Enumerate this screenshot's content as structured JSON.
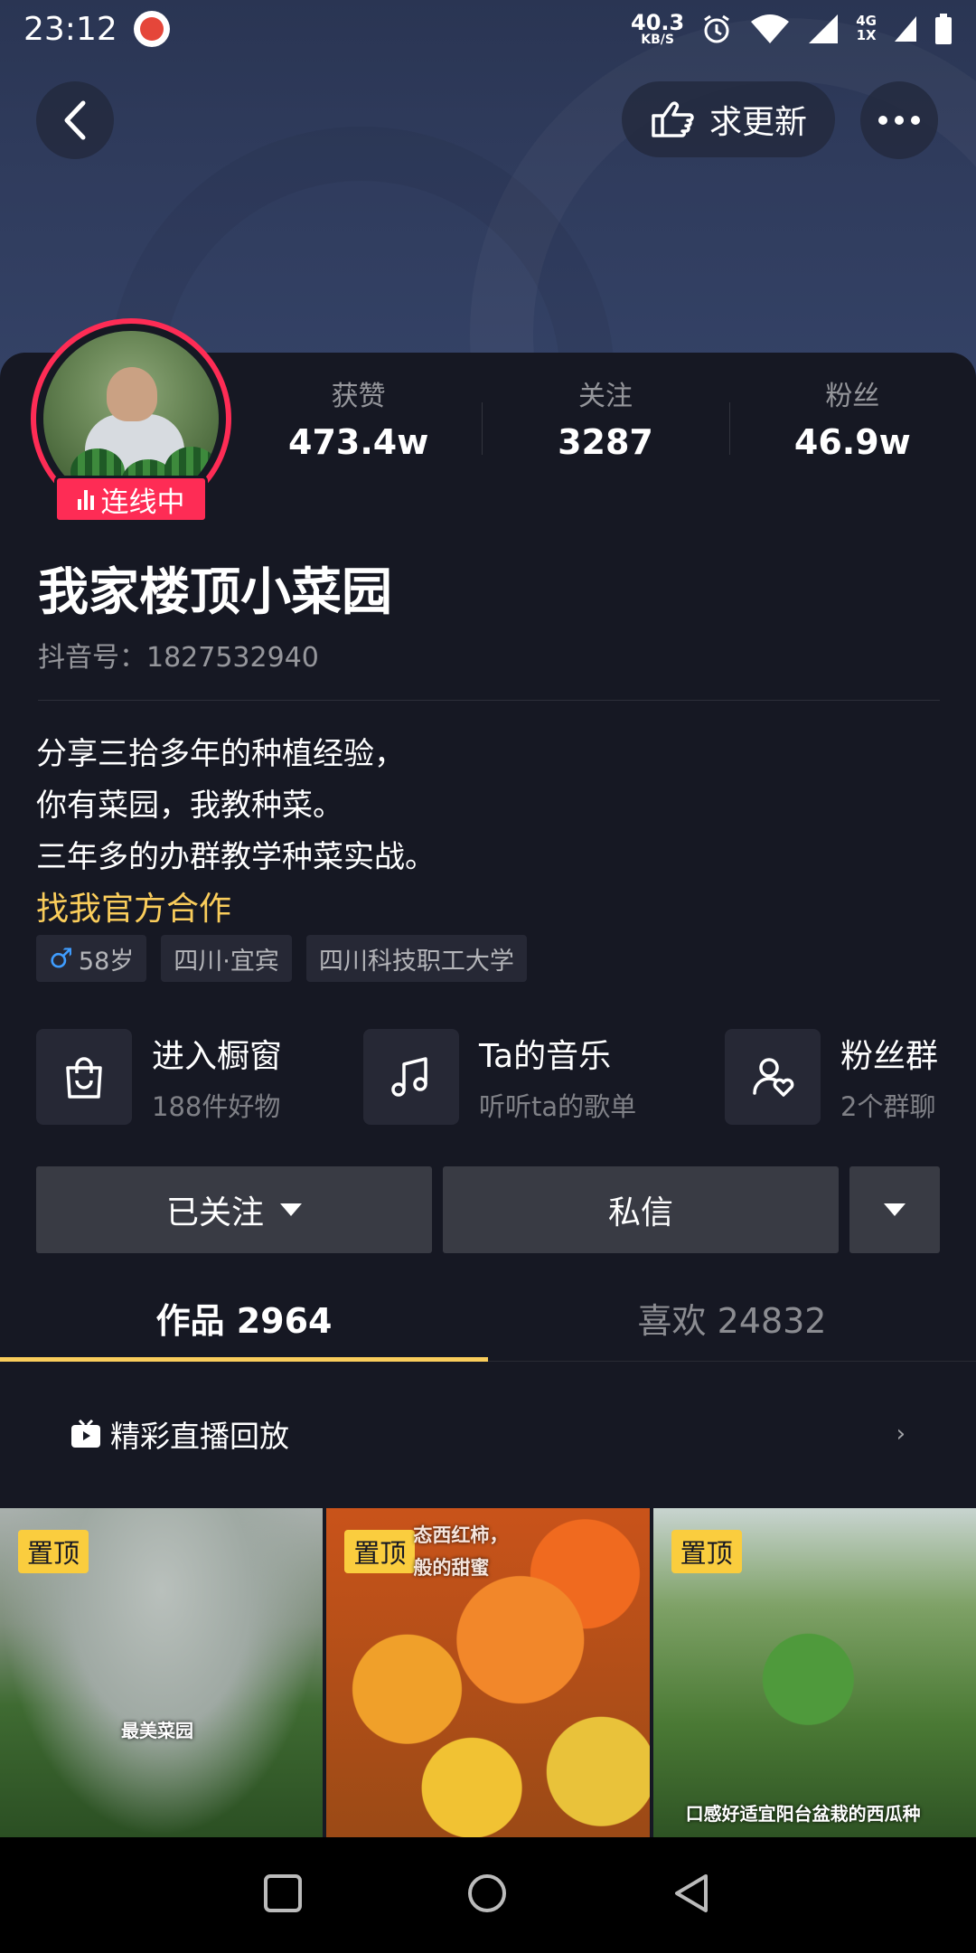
{
  "status_bar": {
    "time": "23:12",
    "net_speed_value": "40.3",
    "net_speed_unit": "KB/S",
    "network_type_top": "4G",
    "network_type_bottom": "1X"
  },
  "header": {
    "update_label": "求更新"
  },
  "profile": {
    "live_badge": "连线中",
    "name": "我家楼顶小菜园",
    "douyin_id": "抖音号：1827532940",
    "stats": [
      {
        "label": "获赞",
        "value": "473.4w"
      },
      {
        "label": "关注",
        "value": "3287"
      },
      {
        "label": "粉丝",
        "value": "46.9w"
      }
    ],
    "bio_lines": [
      "分享三拾多年的种植经验，",
      "你有菜园，我教种菜。",
      "三年多的办群教学种菜实战。"
    ],
    "bio_link": "找我官方合作",
    "tags": {
      "age": "58岁",
      "location": "四川·宜宾",
      "school": "四川科技职工大学"
    }
  },
  "shortcuts": [
    {
      "title": "进入橱窗",
      "subtitle": "188件好物",
      "icon": "shopping-bag-icon"
    },
    {
      "title": "Ta的音乐",
      "subtitle": "听听ta的歌单",
      "icon": "music-note-icon"
    },
    {
      "title": "粉丝群",
      "subtitle": "2个群聊",
      "icon": "fan-group-icon"
    }
  ],
  "actions": {
    "followed_label": "已关注",
    "message_label": "私信"
  },
  "tabs": [
    {
      "label": "作品 2964",
      "active": true
    },
    {
      "label": "喜欢 24832",
      "active": false
    }
  ],
  "live_replay_label": "精彩直播回放",
  "videos": [
    {
      "pin_label": "置顶",
      "overlay_text": "最美菜园"
    },
    {
      "pin_label": "置顶",
      "overlay_text": "态西红柿，\n般的甜蜜"
    },
    {
      "pin_label": "置顶",
      "overlay_text": "口感好适宜阳台盆栽的西瓜种"
    }
  ],
  "colors": {
    "accent_yellow": "#facd5b",
    "live_red": "#fe2c55",
    "background": "#161823",
    "button_gray": "#393b44"
  }
}
